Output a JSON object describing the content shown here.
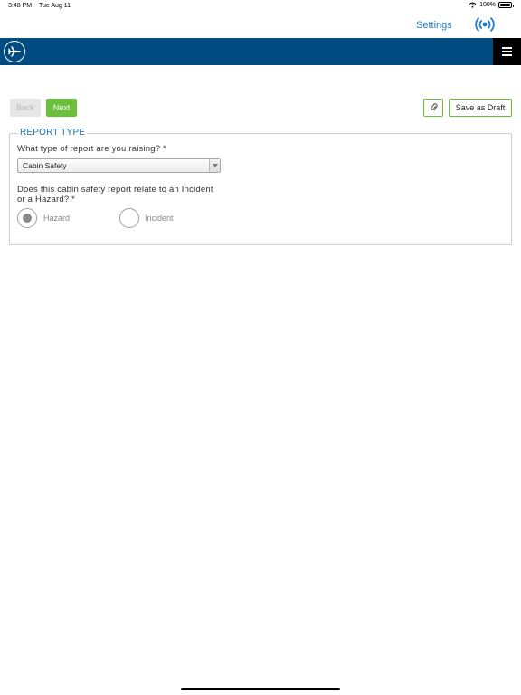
{
  "status_bar": {
    "time": "3:48 PM",
    "date": "Tue Aug 11",
    "battery": "100%"
  },
  "top_nav": {
    "settings_label": "Settings"
  },
  "toolbar": {
    "back_label": "Back",
    "next_label": "Next",
    "draft_label": "Save as Draft"
  },
  "form": {
    "section_title": "REPORT TYPE",
    "report_type_question": "What type of report are you raising? *",
    "report_type_value": "Cabin Safety",
    "relation_question": "Does this cabin safety report relate to an Incident or a Hazard? *",
    "options": [
      {
        "label": "Hazard",
        "selected": true
      },
      {
        "label": "Incident",
        "selected": false
      }
    ]
  },
  "colors": {
    "header": "#004b7f",
    "accent_green": "#6cbf3a",
    "link_blue": "#1e7bd1",
    "legend_blue": "#1e6fae"
  }
}
